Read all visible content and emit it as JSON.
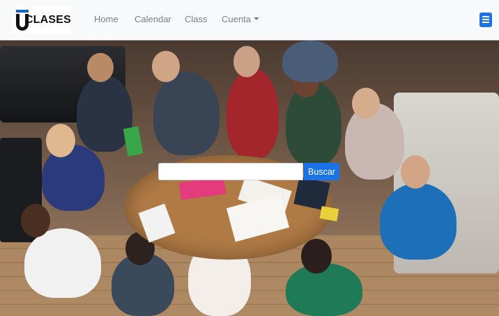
{
  "brand": {
    "name": "CLASES",
    "logo_icon": "u-logo-icon",
    "accent": "#1565c0"
  },
  "nav": {
    "links": [
      {
        "label": "Home"
      },
      {
        "label": "Calendar"
      },
      {
        "label": "Class"
      },
      {
        "label": "Cuenta"
      }
    ],
    "dropdown_icon": "caret-down-icon",
    "book_icon": "book-icon",
    "book_color": "#1a73e8"
  },
  "search": {
    "placeholder": "",
    "value": "",
    "button_label": "Buscar"
  },
  "hero": {
    "image_icon": "students-studying-photo"
  }
}
